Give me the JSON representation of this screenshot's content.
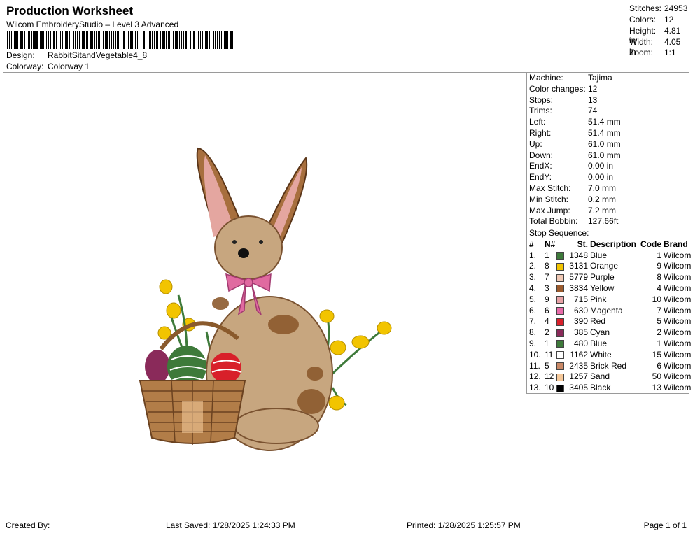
{
  "header": {
    "title": "Production Worksheet",
    "subtitle": "Wilcom EmbroideryStudio – Level 3 Advanced",
    "design_label": "Design:",
    "design_value": "RabbitSitandVegetable4_8",
    "colorway_label": "Colorway:",
    "colorway_value": "Colorway 1"
  },
  "stats": [
    {
      "label": "Stitches:",
      "value": "24953"
    },
    {
      "label": "Colors:",
      "value": "12"
    },
    {
      "label": "Height:",
      "value": "4.81 in"
    },
    {
      "label": "Width:",
      "value": "4.05 in"
    },
    {
      "label": "Zoom:",
      "value": "1:1"
    }
  ],
  "details": [
    {
      "label": "Machine:",
      "value": "Tajima"
    },
    {
      "label": "Color changes:",
      "value": "12"
    },
    {
      "label": "Stops:",
      "value": "13"
    },
    {
      "label": "Trims:",
      "value": "74"
    },
    {
      "label": "Left:",
      "value": "51.4 mm"
    },
    {
      "label": "Right:",
      "value": "51.4 mm"
    },
    {
      "label": "Up:",
      "value": "61.0 mm"
    },
    {
      "label": "Down:",
      "value": "61.0 mm"
    },
    {
      "label": "EndX:",
      "value": "0.00 in"
    },
    {
      "label": "EndY:",
      "value": "0.00 in"
    },
    {
      "label": "Max Stitch:",
      "value": "7.0 mm"
    },
    {
      "label": "Min Stitch:",
      "value": "0.2 mm"
    },
    {
      "label": "Max Jump:",
      "value": "7.2 mm"
    },
    {
      "label": "Total Bobbin:",
      "value": "127.66ft"
    }
  ],
  "stop_sequence": {
    "title": "Stop Sequence:",
    "headers": [
      "#",
      "N#",
      "St.",
      "Description",
      "Code",
      "Brand"
    ],
    "rows": [
      {
        "idx": "1.",
        "n": "1",
        "color": "#3e7a3a",
        "st": "1348",
        "desc": "Blue",
        "code": "1",
        "brand": "Wilcom"
      },
      {
        "idx": "2.",
        "n": "8",
        "color": "#f2c400",
        "st": "3131",
        "desc": "Orange",
        "code": "9",
        "brand": "Wilcom"
      },
      {
        "idx": "3.",
        "n": "7",
        "color": "#f0c8b4",
        "st": "5779",
        "desc": "Purple",
        "code": "8",
        "brand": "Wilcom"
      },
      {
        "idx": "4.",
        "n": "3",
        "color": "#9c5a2c",
        "st": "3834",
        "desc": "Yellow",
        "code": "4",
        "brand": "Wilcom"
      },
      {
        "idx": "5.",
        "n": "9",
        "color": "#e8a2a6",
        "st": "715",
        "desc": "Pink",
        "code": "10",
        "brand": "Wilcom"
      },
      {
        "idx": "6.",
        "n": "6",
        "color": "#e86aa8",
        "st": "630",
        "desc": "Magenta",
        "code": "7",
        "brand": "Wilcom"
      },
      {
        "idx": "7.",
        "n": "4",
        "color": "#d8202a",
        "st": "390",
        "desc": "Red",
        "code": "5",
        "brand": "Wilcom"
      },
      {
        "idx": "8.",
        "n": "2",
        "color": "#8a2a5a",
        "st": "385",
        "desc": "Cyan",
        "code": "2",
        "brand": "Wilcom"
      },
      {
        "idx": "9.",
        "n": "1",
        "color": "#3e7a3a",
        "st": "480",
        "desc": "Blue",
        "code": "1",
        "brand": "Wilcom"
      },
      {
        "idx": "10.",
        "n": "11",
        "color": "#ffffff",
        "st": "1162",
        "desc": "White",
        "code": "15",
        "brand": "Wilcom"
      },
      {
        "idx": "11.",
        "n": "5",
        "color": "#c98866",
        "st": "2435",
        "desc": "Brick Red",
        "code": "6",
        "brand": "Wilcom"
      },
      {
        "idx": "12.",
        "n": "12",
        "color": "#f5c89a",
        "st": "1257",
        "desc": "Sand",
        "code": "50",
        "brand": "Wilcom"
      },
      {
        "idx": "13.",
        "n": "10",
        "color": "#000000",
        "st": "3405",
        "desc": "Black",
        "code": "13",
        "brand": "Wilcom"
      }
    ]
  },
  "footer": {
    "created_by": "Created By:",
    "last_saved": "Last Saved: 1/28/2025 1:24:33 PM",
    "printed": "Printed: 1/28/2025 1:25:57 PM",
    "page": "Page 1 of 1"
  }
}
